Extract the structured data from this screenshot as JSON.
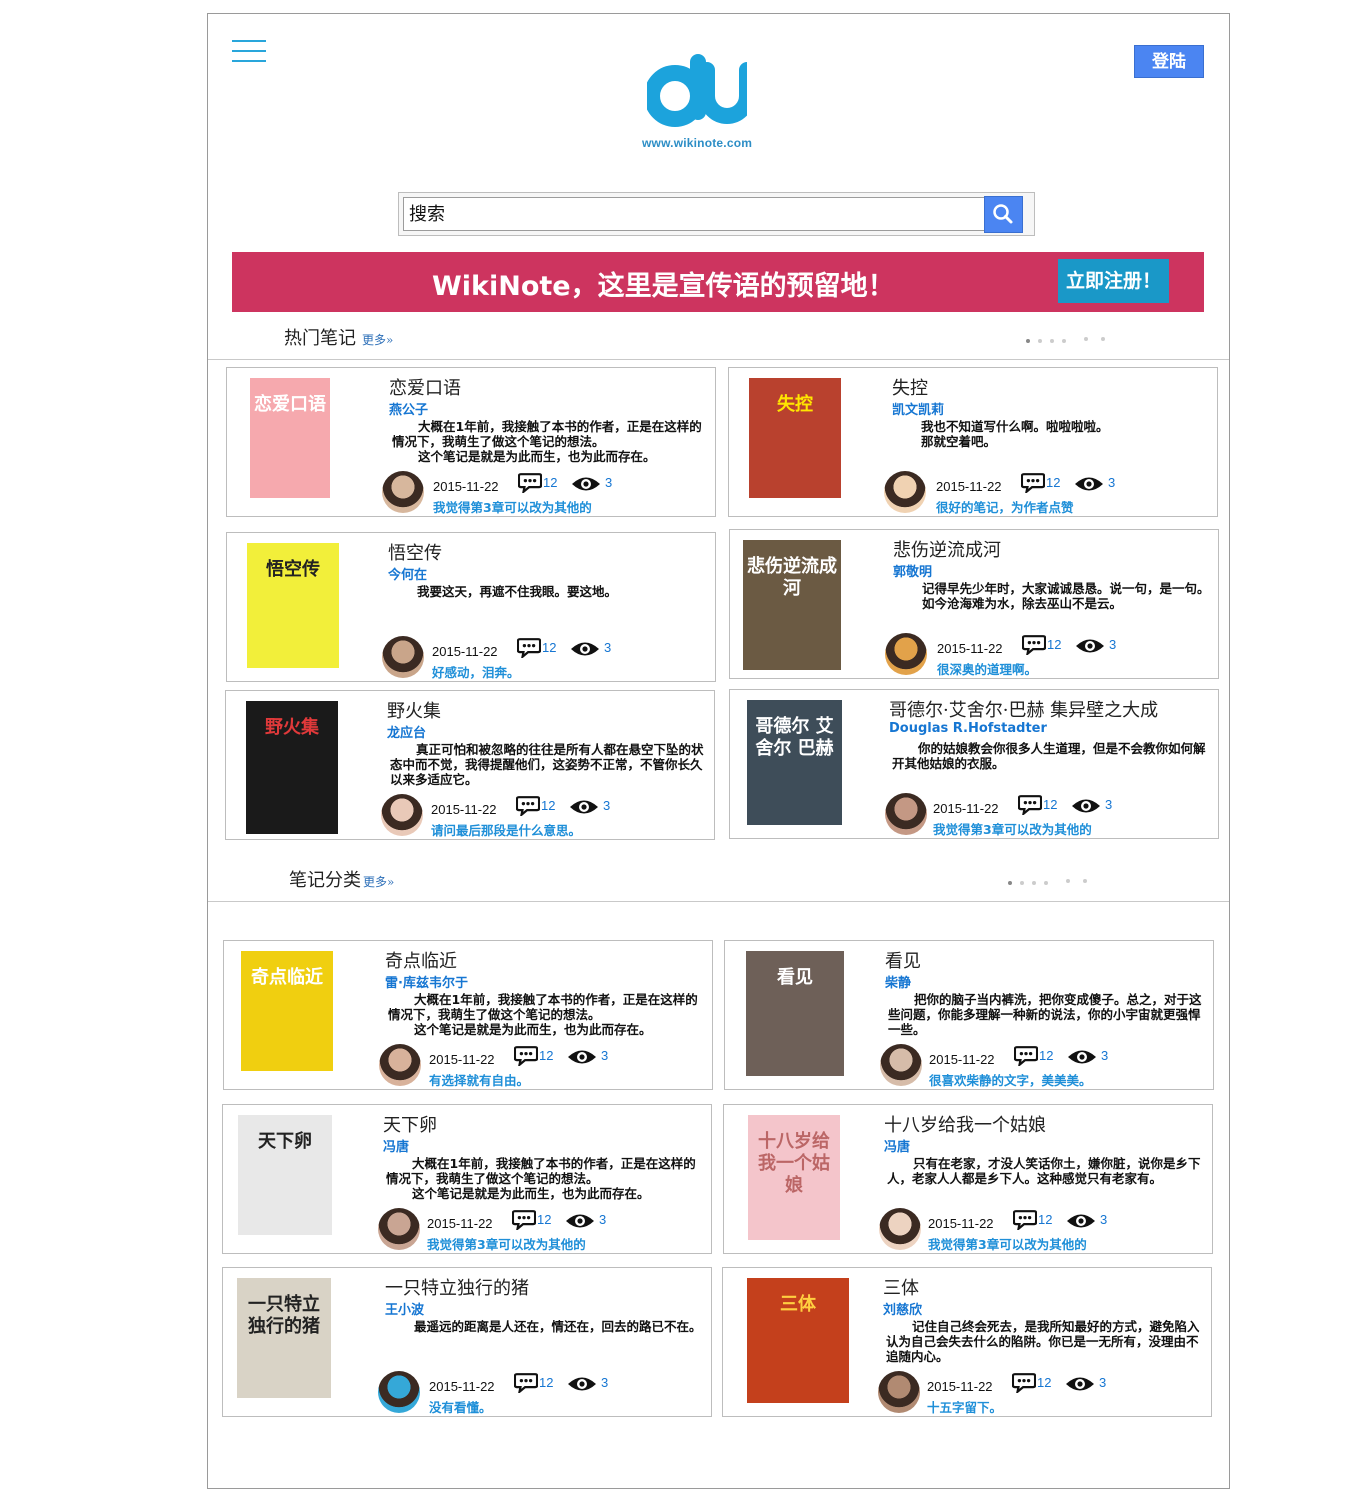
{
  "header": {
    "menu_icon": "hamburger-icon",
    "login_label": "登陆",
    "logo_text": "du",
    "logo_url": "www.wikinote.com"
  },
  "search": {
    "placeholder": "搜索",
    "icon": "search-icon"
  },
  "banner": {
    "text": "WikiNote，这里是宣传语的预留地！",
    "register_label": "立即注册！",
    "color": "#cd345f",
    "button_color": "#1a98c8"
  },
  "hot_notes": {
    "title": "热门笔记",
    "more": "更多»",
    "prev_icon": "‹",
    "next_icon": "›",
    "cards": [
      {
        "title": "恋爱口语",
        "author": "燕公子",
        "desc": [
          "大概在1年前，我接触了本书的作者，正是在这样的情况下，我萌生了做这个笔记的想法。",
          "这个笔记是就是为此而生，也为此而存在。"
        ],
        "date": "2015-11-22",
        "comments": "12",
        "views": "3",
        "comment": "我觉得第3章可以改为其他的"
      },
      {
        "title": "失控",
        "author": "凯文凯莉",
        "desc": [
          "我也不知道写什么啊。啦啦啦啦。",
          "那就空着吧。"
        ],
        "date": "2015-11-22",
        "comments": "12",
        "views": "3",
        "comment": "很好的笔记，为作者点赞"
      },
      {
        "title": "悟空传",
        "author": "今何在",
        "desc": [
          "我要这天，再遮不住我眼。要这地。"
        ],
        "date": "2015-11-22",
        "comments": "12",
        "views": "3",
        "comment": "好感动，泪奔。"
      },
      {
        "title": "悲伤逆流成河",
        "author": "郭敬明",
        "desc": [
          "记得早先少年时，大家诚诚恳恳。说一句，是一句。",
          "如今沧海难为水，除去巫山不是云。"
        ],
        "date": "2015-11-22",
        "comments": "12",
        "views": "3",
        "comment": "很深奥的道理啊。"
      },
      {
        "title": "野火集",
        "author": "龙应台",
        "desc": [
          "真正可怕和被忽略的往往是所有人都在悬空下坠的状态中而不觉，我得提醒他们，这姿势不正常，不管你长久以来多适应它。"
        ],
        "date": "2015-11-22",
        "comments": "12",
        "views": "3",
        "comment": "请问最后那段是什么意思。"
      },
      {
        "title": "哥德尔·艾舍尔·巴赫 集异壁之大成",
        "author": "Douglas R.Hofstadter",
        "desc": [
          "你的姑娘教会你很多人生道理，但是不会教你如何解开其他姑娘的衣服。"
        ],
        "date": "2015-11-22",
        "comments": "12",
        "views": "3",
        "comment": "我觉得第3章可以改为其他的"
      }
    ]
  },
  "categories": {
    "title": "笔记分类",
    "more": "更多»",
    "prev_icon": "‹",
    "next_icon": "›",
    "cards": [
      {
        "title": "奇点临近",
        "author": "雷·库兹韦尔于",
        "desc": [
          "大概在1年前，我接触了本书的作者，正是在这样的情况下，我萌生了做这个笔记的想法。",
          "这个笔记是就是为此而生，也为此而存在。"
        ],
        "date": "2015-11-22",
        "comments": "12",
        "views": "3",
        "comment": "有选择就有自由。"
      },
      {
        "title": "看见",
        "author": "柴静",
        "desc": [
          "把你的脑子当内裤洗，把你变成傻子。总之，对于这些问题，你能多理解一种新的说法，你的小宇宙就更强悍一些。"
        ],
        "date": "2015-11-22",
        "comments": "12",
        "views": "3",
        "comment": "很喜欢柴静的文字，美美美。"
      },
      {
        "title": "天下卵",
        "author": "冯唐",
        "desc": [
          "大概在1年前，我接触了本书的作者，正是在这样的情况下，我萌生了做这个笔记的想法。",
          "这个笔记是就是为此而生，也为此而存在。"
        ],
        "date": "2015-11-22",
        "comments": "12",
        "views": "3",
        "comment": "我觉得第3章可以改为其他的"
      },
      {
        "title": "十八岁给我一个姑娘",
        "author": "冯唐",
        "desc": [
          "只有在老家，才没人笑话你土，嫌你脏，说你是乡下人，老家人人都是乡下人。这种感觉只有老家有。"
        ],
        "date": "2015-11-22",
        "comments": "12",
        "views": "3",
        "comment": "我觉得第3章可以改为其他的"
      },
      {
        "title": "一只特立独行的猪",
        "author": "王小波",
        "desc": [
          "最遥远的距离是人还在，情还在，回去的路已不在。"
        ],
        "date": "2015-11-22",
        "comments": "12",
        "views": "3",
        "comment": "没有看懂。"
      },
      {
        "title": "三体",
        "author": "刘慈欣",
        "desc": [
          "记住自己终会死去，是我所知最好的方式，避免陷入认为自己会失去什么的陷阱。你已是一无所有，没理由不追随内心。"
        ],
        "date": "2015-11-22",
        "comments": "12",
        "views": "3",
        "comment": "十五字留下。"
      }
    ]
  },
  "cover_texts": {
    "c0": "恋爱口语",
    "c1": "失控",
    "c2": "悟空传",
    "c3": "悲伤逆流成河",
    "c4": "野火集",
    "c5": "哥德尔 艾舍尔 巴赫",
    "c6": "奇点临近",
    "c7": "看见",
    "c8": "天下卵",
    "c9": "十八岁给我一个姑娘",
    "c10": "一只特立独行的猪",
    "c11": "三体"
  }
}
